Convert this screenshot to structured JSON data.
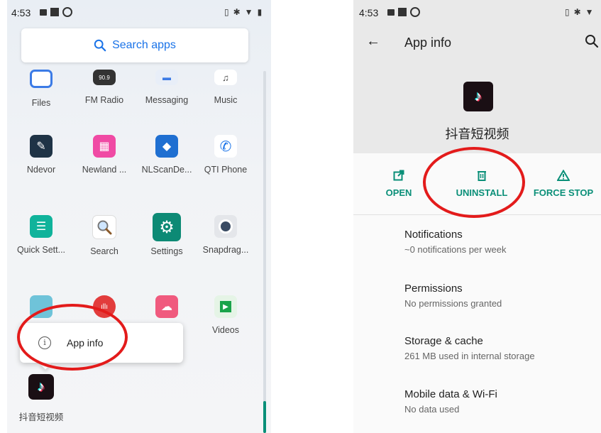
{
  "left": {
    "status": {
      "time": "4:53"
    },
    "search": {
      "label": "Search apps"
    },
    "apps": [
      {
        "label": "Files",
        "icon": "files-icon"
      },
      {
        "label": "FM Radio",
        "icon": "fm-radio-icon"
      },
      {
        "label": "Messaging",
        "icon": "messaging-icon"
      },
      {
        "label": "Music",
        "icon": "music-icon"
      },
      {
        "label": "Ndevor",
        "icon": "ndevor-icon"
      },
      {
        "label": "Newland ...",
        "icon": "newland-icon"
      },
      {
        "label": "NLScanDe...",
        "icon": "nlscan-icon"
      },
      {
        "label": "QTI Phone",
        "icon": "phone-icon"
      },
      {
        "label": "Quick Sett...",
        "icon": "quick-settings-icon"
      },
      {
        "label": "Search",
        "icon": "search-icon"
      },
      {
        "label": "Settings",
        "icon": "settings-gear-icon"
      },
      {
        "label": "Snapdrag...",
        "icon": "camera-icon"
      },
      {
        "label": "Videos",
        "icon": "videos-play-icon"
      },
      {
        "label": "抖音短视频",
        "icon": "tiktok-icon"
      }
    ],
    "popup": {
      "label": "App info"
    }
  },
  "right": {
    "status": {
      "time": "4:53"
    },
    "header": {
      "title": "App info"
    },
    "app_name": "抖音短视频",
    "actions": {
      "open": "OPEN",
      "uninstall": "UNINSTALL",
      "force_stop": "FORCE STOP"
    },
    "rows": [
      {
        "title": "Notifications",
        "subtitle": "~0 notifications per week"
      },
      {
        "title": "Permissions",
        "subtitle": "No permissions granted"
      },
      {
        "title": "Storage & cache",
        "subtitle": "261 MB used in internal storage"
      },
      {
        "title": "Mobile data & Wi-Fi",
        "subtitle": "No data used"
      }
    ]
  },
  "colors": {
    "accent": "#0a8f78",
    "annotation": "#e31b1b",
    "search_blue": "#1a73e8"
  }
}
